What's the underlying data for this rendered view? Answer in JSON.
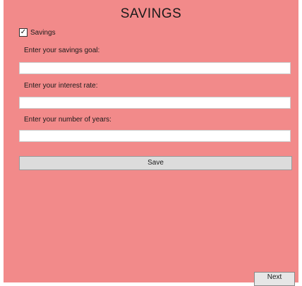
{
  "title": "SAVINGS",
  "savings_checkbox": {
    "label": "Savings",
    "checked": true,
    "check_glyph": "✓"
  },
  "fields": [
    {
      "label": "Enter your savings goal:",
      "value": ""
    },
    {
      "label": "Enter your interest rate:",
      "value": ""
    },
    {
      "label": "Enter your number of years:",
      "value": ""
    }
  ],
  "save_button": {
    "label": "Save"
  },
  "next_button": {
    "label": "Next"
  },
  "colors": {
    "panel_background": "#f28a8a",
    "button_background": "#dcdcdc"
  }
}
